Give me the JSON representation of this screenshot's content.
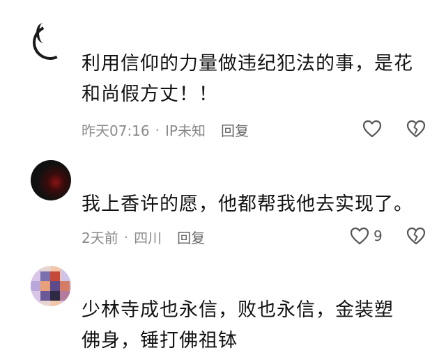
{
  "comments": [
    {
      "text": "利用信仰的力量做违纪犯法的事，是花和尚假方丈！！",
      "time": "昨天07:16",
      "location": "IP未知",
      "reply_label": "回复",
      "like_count": "",
      "icons": {
        "like": "heart-outline-icon",
        "dislike": "broken-heart-icon"
      }
    },
    {
      "text": "我上香许的愿，他都帮我他去实现了。",
      "time": "2天前",
      "location": "四川",
      "reply_label": "回复",
      "like_count": "9",
      "icons": {
        "like": "heart-outline-icon",
        "dislike": "broken-heart-icon"
      }
    },
    {
      "text": "少林寺成也永信，败也永信，金装塑佛身，锤打佛祖钵"
    }
  ],
  "colors": {
    "text": "#121212",
    "meta": "#8a8a8a",
    "icon": "#555555"
  }
}
